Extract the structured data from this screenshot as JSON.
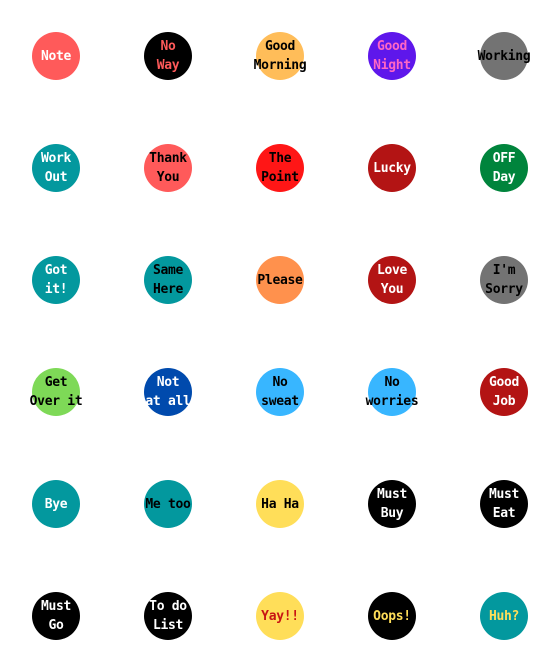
{
  "stickers": [
    {
      "text": "Note",
      "bg": "#ff5a5a",
      "fg": "#ffffff"
    },
    {
      "text": "No\nWay",
      "bg": "#000000",
      "fg": "#ff5a5a"
    },
    {
      "text": "Good\nMorning",
      "bg": "#ffbd59",
      "fg": "#000000"
    },
    {
      "text": "Good\nNight",
      "bg": "#5e17eb",
      "fg": "#ff66c4"
    },
    {
      "text": "Working",
      "bg": "#737373",
      "fg": "#000000"
    },
    {
      "text": "Work\nOut",
      "bg": "#03989e",
      "fg": "#ffffff"
    },
    {
      "text": "Thank\nYou",
      "bg": "#ff5a5a",
      "fg": "#000000"
    },
    {
      "text": "The\nPoint",
      "bg": "#ff1616",
      "fg": "#000000"
    },
    {
      "text": "Lucky",
      "bg": "#b31414",
      "fg": "#ffffff"
    },
    {
      "text": "OFF\nDay",
      "bg": "#00843c",
      "fg": "#ffffff"
    },
    {
      "text": "Got\nit!",
      "bg": "#03989e",
      "fg": "#ffffff"
    },
    {
      "text": "Same\nHere",
      "bg": "#03989e",
      "fg": "#000000"
    },
    {
      "text": "Please",
      "bg": "#ff914d",
      "fg": "#000000"
    },
    {
      "text": "Love\nYou",
      "bg": "#b31414",
      "fg": "#ffffff"
    },
    {
      "text": "I'm\nSorry",
      "bg": "#737373",
      "fg": "#000000"
    },
    {
      "text": "Get\nOver it",
      "bg": "#7ed957",
      "fg": "#000000"
    },
    {
      "text": "Not\nat all",
      "bg": "#004aad",
      "fg": "#ffffff"
    },
    {
      "text": "No\nsweat",
      "bg": "#38b6ff",
      "fg": "#000000"
    },
    {
      "text": "No\nworries",
      "bg": "#38b6ff",
      "fg": "#000000"
    },
    {
      "text": "Good\nJob",
      "bg": "#b31414",
      "fg": "#ffffff"
    },
    {
      "text": "Bye",
      "bg": "#03989e",
      "fg": "#ffffff"
    },
    {
      "text": "Me too",
      "bg": "#03989e",
      "fg": "#000000"
    },
    {
      "text": "Ha Ha",
      "bg": "#ffde59",
      "fg": "#000000"
    },
    {
      "text": "Must\nBuy",
      "bg": "#000000",
      "fg": "#ffffff"
    },
    {
      "text": "Must\nEat",
      "bg": "#000000",
      "fg": "#ffffff"
    },
    {
      "text": "Must\nGo",
      "bg": "#000000",
      "fg": "#ffffff"
    },
    {
      "text": "To do\nList",
      "bg": "#000000",
      "fg": "#ffffff"
    },
    {
      "text": "Yay!!",
      "bg": "#ffde59",
      "fg": "#c81414"
    },
    {
      "text": "Oops!",
      "bg": "#000000",
      "fg": "#ffde59"
    },
    {
      "text": "Huh?",
      "bg": "#03989e",
      "fg": "#ffde59"
    }
  ]
}
